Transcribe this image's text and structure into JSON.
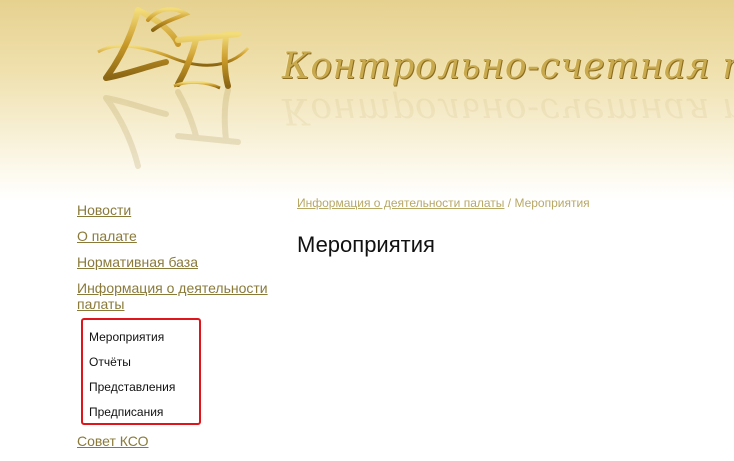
{
  "header": {
    "site_title": "Контрольно-счетная палата Л"
  },
  "sidebar": {
    "items": [
      {
        "label": "Новости"
      },
      {
        "label": "О палате"
      },
      {
        "label": "Нормативная база"
      },
      {
        "label": "Информация о деятельности палаты"
      },
      {
        "label": "Совет КСО"
      }
    ],
    "submenu": [
      {
        "label": "Мероприятия"
      },
      {
        "label": "Отчёты"
      },
      {
        "label": "Представления"
      },
      {
        "label": "Предписания"
      }
    ]
  },
  "breadcrumb": {
    "parent": "Информация о деятельности палаты",
    "separator": " / ",
    "current": "Мероприятия"
  },
  "main": {
    "title": "Мероприятия"
  },
  "colors": {
    "header_gold": "#e6d18f",
    "link": "#8a7a3a",
    "breadcrumb": "#b8a866",
    "highlight_border": "#e0151b"
  },
  "icons": {
    "logo": "ksp-monogram-logo"
  }
}
